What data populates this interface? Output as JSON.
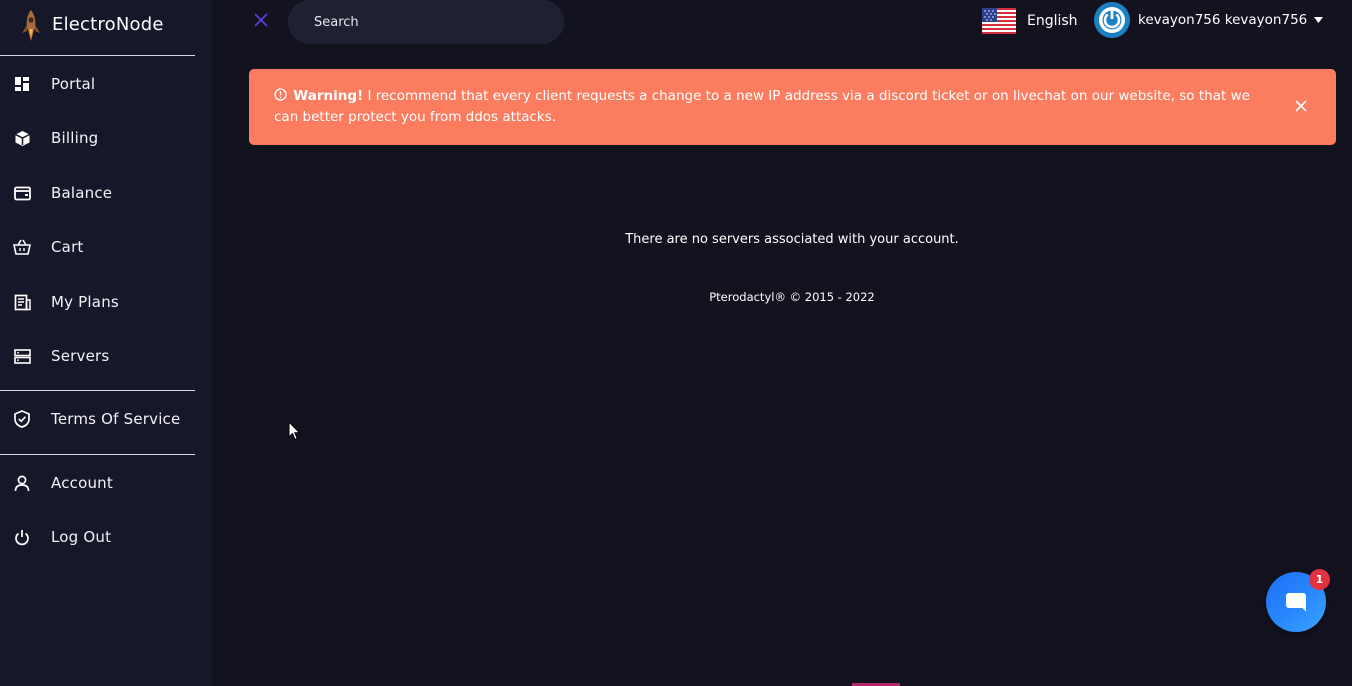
{
  "brand": {
    "name": "ElectroNode",
    "logo_icon": "rocket-logo"
  },
  "sidebar": {
    "items": [
      {
        "label": "Portal",
        "icon": "dashboard-icon"
      },
      {
        "label": "Billing",
        "icon": "cube-icon"
      },
      {
        "label": "Balance",
        "icon": "wallet-icon"
      },
      {
        "label": "Cart",
        "icon": "basket-icon"
      },
      {
        "label": "My Plans",
        "icon": "receipt-icon"
      },
      {
        "label": "Servers",
        "icon": "server-icon"
      },
      {
        "label": "Terms Of Service",
        "icon": "shield-check-icon"
      },
      {
        "label": "Account",
        "icon": "user-icon"
      },
      {
        "label": "Log Out",
        "icon": "power-icon"
      }
    ]
  },
  "topbar": {
    "search_placeholder": "Search",
    "language": "English",
    "username": "kevayon756 kevayon756"
  },
  "alert": {
    "title": "Warning!",
    "message": " I recommend that every client requests a change to a new IP address via a discord ticket or on livechat on our website, so that we can better protect you from ddos attacks.",
    "color": "#fb7c5e"
  },
  "main": {
    "empty_message": "There are no servers associated with your account.",
    "footer": "Pterodactyl® © 2015 - 2022"
  },
  "chat": {
    "badge_count": "1"
  },
  "colors": {
    "background": "#131320",
    "sidebar": "#17172a",
    "accent": "#2a8bff",
    "close_x": "#5b3fd8"
  }
}
